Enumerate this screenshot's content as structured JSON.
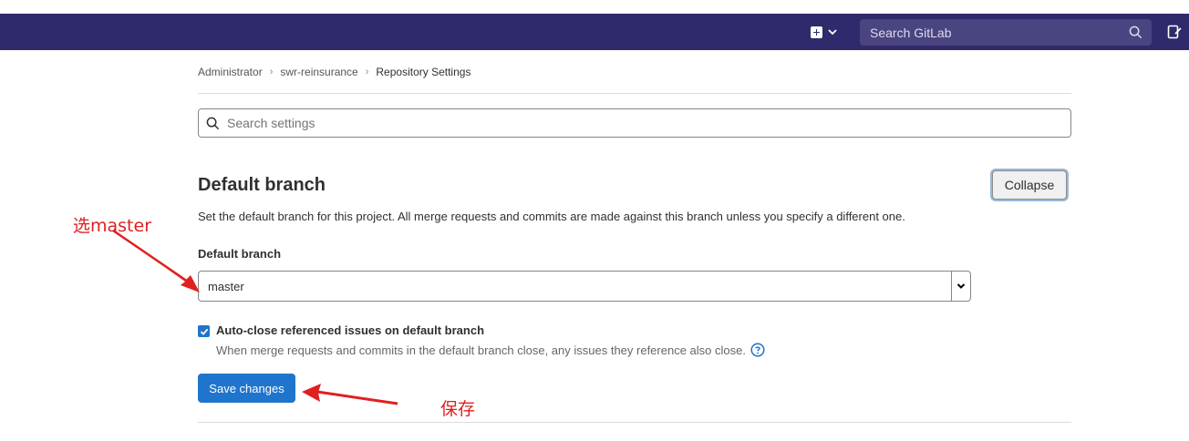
{
  "topbar": {
    "search_placeholder": "Search GitLab",
    "new_menu_icon": "plus-square-icon",
    "todo_icon": "todo-icon",
    "bg_color": "#2f2a6b"
  },
  "breadcrumb": {
    "items": [
      "Administrator",
      "swr-reinsurance",
      "Repository Settings"
    ]
  },
  "settings_search": {
    "placeholder": "Search settings"
  },
  "section": {
    "title": "Default branch",
    "collapse_label": "Collapse",
    "description": "Set the default branch for this project. All merge requests and commits are made against this branch unless you specify a different one.",
    "field_label": "Default branch",
    "selected_branch": "master",
    "checkbox_checked": true,
    "checkbox_label": "Auto-close referenced issues on default branch",
    "checkbox_help": "When merge requests and commits in the default branch close, any issues they reference also close.",
    "save_label": "Save changes"
  },
  "annotations": {
    "select_note": "选master",
    "save_note": "保存",
    "color": "#e02020"
  },
  "colors": {
    "primary": "#1f75cb"
  }
}
